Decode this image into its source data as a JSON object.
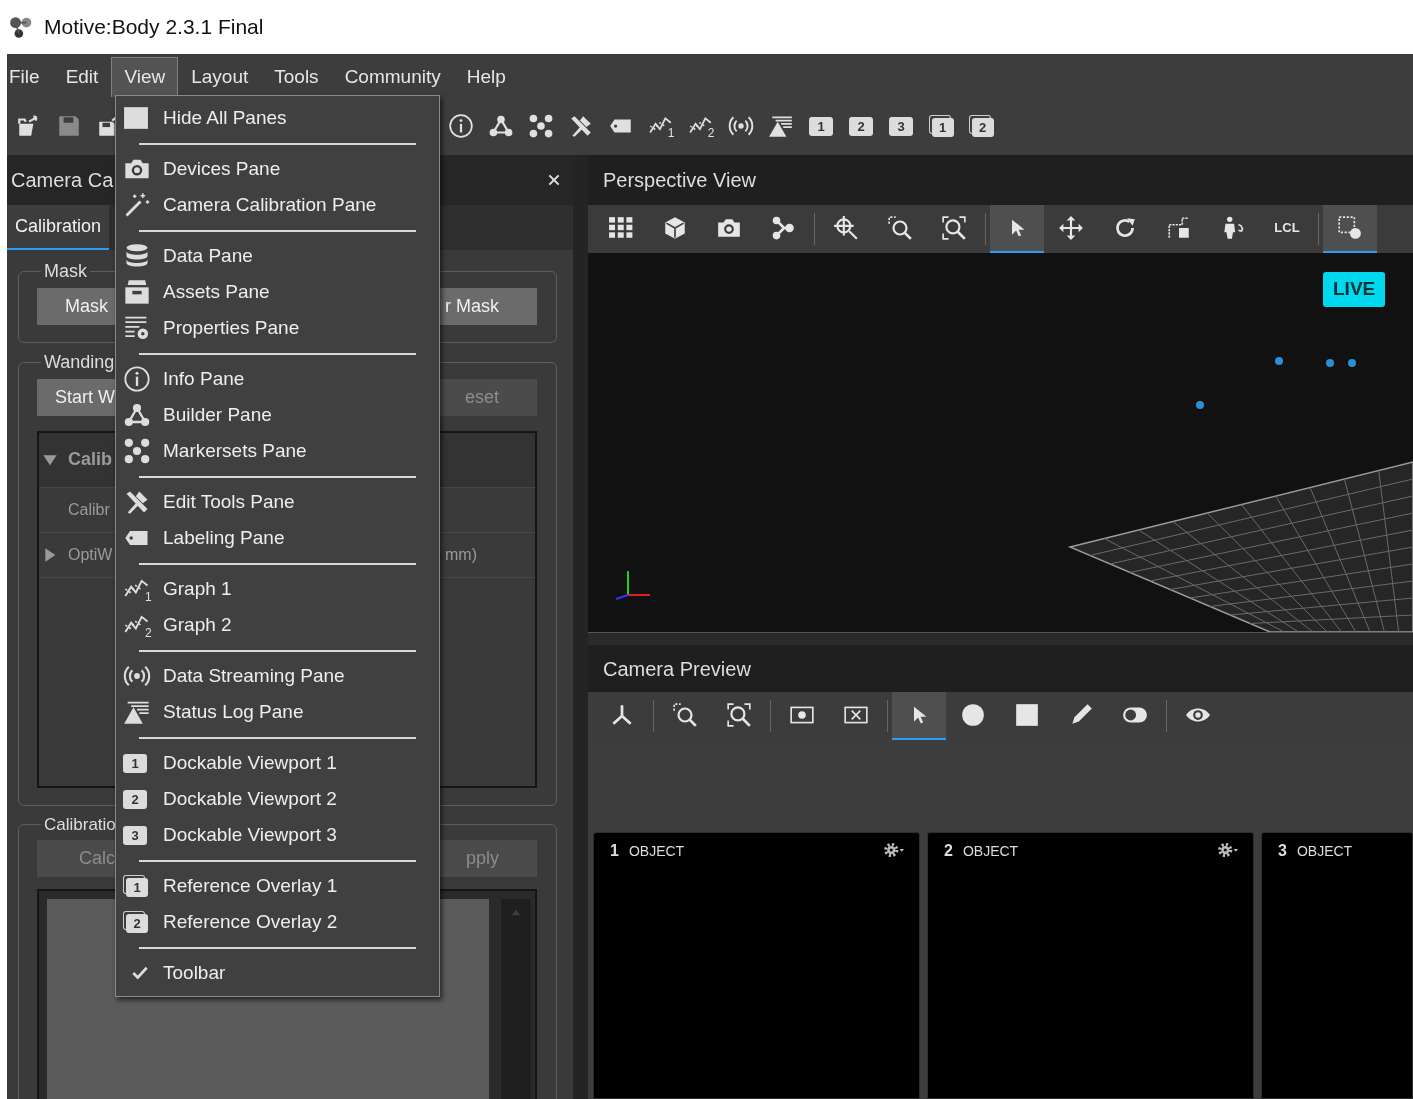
{
  "window": {
    "title": "Motive:Body 2.3.1 Final"
  },
  "menu_bar": [
    {
      "label": "File",
      "selected": false
    },
    {
      "label": "Edit",
      "selected": false
    },
    {
      "label": "View",
      "selected": true
    },
    {
      "label": "Layout",
      "selected": false
    },
    {
      "label": "Tools",
      "selected": false
    },
    {
      "label": "Community",
      "selected": false
    },
    {
      "label": "Help",
      "selected": false
    }
  ],
  "toolbar": [
    {
      "disabled": false
    },
    {
      "disabled": true
    },
    {
      "disabled": false
    },
    {
      "disabled": false
    },
    {
      "disabled": false
    },
    {
      "disabled": false
    },
    {
      "disabled": false
    },
    {
      "disabled": false
    },
    {
      "disabled": false,
      "badge": "1"
    },
    {
      "disabled": false,
      "badge": "2"
    },
    {
      "disabled": false
    },
    {
      "disabled": false
    },
    {
      "disabled": false,
      "badge": "1"
    },
    {
      "disabled": false,
      "badge": "2"
    },
    {
      "disabled": false,
      "badge": "3"
    },
    {
      "disabled": false,
      "badge": "1"
    },
    {
      "disabled": false,
      "badge": "2"
    }
  ],
  "view_menu": {
    "items": [
      {
        "kind": "item",
        "label": "Hide All Panes",
        "checked": false
      },
      {
        "kind": "separator"
      },
      {
        "kind": "item",
        "label": "Devices Pane",
        "checked": false
      },
      {
        "kind": "item",
        "label": "Camera Calibration Pane",
        "checked": false
      },
      {
        "kind": "separator"
      },
      {
        "kind": "item",
        "label": "Data Pane",
        "checked": false
      },
      {
        "kind": "item",
        "label": "Assets Pane",
        "checked": false
      },
      {
        "kind": "item",
        "label": "Properties Pane",
        "checked": false
      },
      {
        "kind": "separator"
      },
      {
        "kind": "item",
        "label": "Info Pane",
        "checked": false
      },
      {
        "kind": "item",
        "label": "Builder Pane",
        "checked": false
      },
      {
        "kind": "item",
        "label": "Markersets Pane",
        "checked": false
      },
      {
        "kind": "separator"
      },
      {
        "kind": "item",
        "label": "Edit Tools Pane",
        "checked": false
      },
      {
        "kind": "item",
        "label": "Labeling Pane",
        "checked": false
      },
      {
        "kind": "separator"
      },
      {
        "kind": "item",
        "label": "Graph 1",
        "checked": false,
        "badge": "1"
      },
      {
        "kind": "item",
        "label": "Graph 2",
        "checked": false,
        "badge": "2"
      },
      {
        "kind": "separator"
      },
      {
        "kind": "item",
        "label": "Data Streaming Pane",
        "checked": false
      },
      {
        "kind": "item",
        "label": "Status Log Pane",
        "checked": false
      },
      {
        "kind": "separator"
      },
      {
        "kind": "item",
        "label": "Dockable Viewport 1",
        "checked": false,
        "badge": "1"
      },
      {
        "kind": "item",
        "label": "Dockable Viewport 2",
        "checked": false,
        "badge": "2"
      },
      {
        "kind": "item",
        "label": "Dockable Viewport 3",
        "checked": false,
        "badge": "3"
      },
      {
        "kind": "separator"
      },
      {
        "kind": "item",
        "label": "Reference Overlay 1",
        "checked": false,
        "badge": "1"
      },
      {
        "kind": "item",
        "label": "Reference Overlay 2",
        "checked": false,
        "badge": "2"
      },
      {
        "kind": "separator"
      },
      {
        "kind": "item",
        "label": "Toolbar",
        "checked": true
      }
    ]
  },
  "camera_calibration_pane": {
    "title": "Camera Ca",
    "tabs": [
      {
        "label": "Calibration",
        "selected": true
      }
    ],
    "groups": [
      {
        "kind": "plain",
        "title": "Mask",
        "buttons": [
          {
            "label": "Mask",
            "disabled": false
          },
          {
            "label": "r Mask",
            "disabled": false
          }
        ]
      },
      {
        "kind": "tree",
        "title": "Wanding",
        "buttons": [
          {
            "label": "Start W",
            "disabled": false
          },
          {
            "label": "eset",
            "disabled": true
          }
        ],
        "tree": [
          {
            "kind": "header",
            "label": "Calib",
            "expanded": true
          },
          {
            "kind": "row",
            "label": "Calibr"
          },
          {
            "kind": "branch",
            "label": "OptiW",
            "value": "mm)",
            "expanded": false
          }
        ]
      },
      {
        "kind": "list",
        "title": "Calibratio",
        "buttons": [
          {
            "label": "Calc",
            "disabled": true
          },
          {
            "label": "pply",
            "disabled": true
          }
        ]
      }
    ]
  },
  "perspective_view": {
    "title": "Perspective View",
    "live": "LIVE",
    "tools": [
      {
        "kind": "tool",
        "selected": false
      },
      {
        "kind": "tool",
        "selected": false
      },
      {
        "kind": "tool",
        "selected": false
      },
      {
        "kind": "tool",
        "selected": false
      },
      {
        "kind": "separator"
      },
      {
        "kind": "tool",
        "selected": false
      },
      {
        "kind": "tool",
        "selected": false
      },
      {
        "kind": "tool",
        "selected": false
      },
      {
        "kind": "separator"
      },
      {
        "kind": "tool",
        "selected": true
      },
      {
        "kind": "tool",
        "selected": false
      },
      {
        "kind": "tool",
        "selected": false
      },
      {
        "kind": "tool",
        "selected": false
      },
      {
        "kind": "tool",
        "selected": false
      },
      {
        "kind": "tool",
        "label": "LCL",
        "selected": false
      },
      {
        "kind": "separator"
      },
      {
        "kind": "tool",
        "selected": true
      }
    ]
  },
  "camera_preview": {
    "title": "Camera Preview",
    "tools": [
      {
        "kind": "tool",
        "selected": false
      },
      {
        "kind": "separator"
      },
      {
        "kind": "tool",
        "selected": false
      },
      {
        "kind": "tool",
        "selected": false
      },
      {
        "kind": "separator"
      },
      {
        "kind": "tool",
        "selected": false
      },
      {
        "kind": "tool",
        "selected": false
      },
      {
        "kind": "separator"
      },
      {
        "kind": "tool",
        "selected": true
      },
      {
        "kind": "tool",
        "selected": false
      },
      {
        "kind": "tool",
        "selected": false
      },
      {
        "kind": "tool",
        "selected": false
      },
      {
        "kind": "tool",
        "selected": false
      },
      {
        "kind": "separator"
      },
      {
        "kind": "tool",
        "selected": false
      }
    ],
    "cameras": [
      {
        "number": "1",
        "label": "OBJECT",
        "settings": true
      },
      {
        "number": "2",
        "label": "OBJECT",
        "settings": true
      },
      {
        "number": "3",
        "label": "OBJECT",
        "settings": false
      }
    ]
  }
}
